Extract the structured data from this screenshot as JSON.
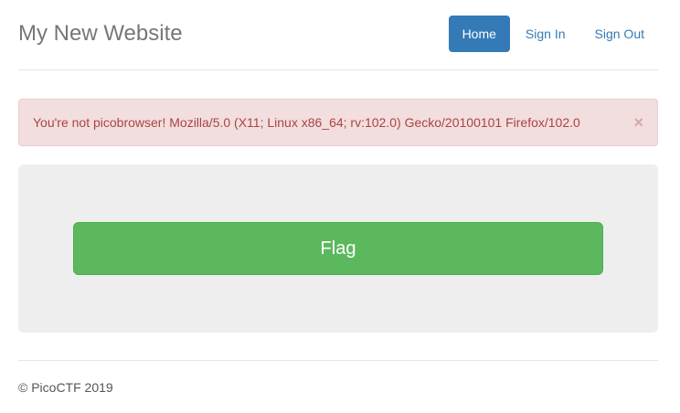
{
  "header": {
    "title": "My New Website",
    "nav": [
      {
        "label": "Home",
        "active": true
      },
      {
        "label": "Sign In",
        "active": false
      },
      {
        "label": "Sign Out",
        "active": false
      }
    ]
  },
  "alert": {
    "message": "You're not picobrowser! Mozilla/5.0 (X11; Linux x86_64; rv:102.0) Gecko/20100101 Firefox/102.0",
    "close_glyph": "×"
  },
  "main": {
    "button_label": "Flag"
  },
  "footer": {
    "text": "© PicoCTF 2019"
  },
  "colors": {
    "primary": "#337ab7",
    "success": "#5cb85c",
    "danger_bg": "#f2dede",
    "danger_text": "#a94442",
    "jumbotron_bg": "#eeeeee"
  }
}
